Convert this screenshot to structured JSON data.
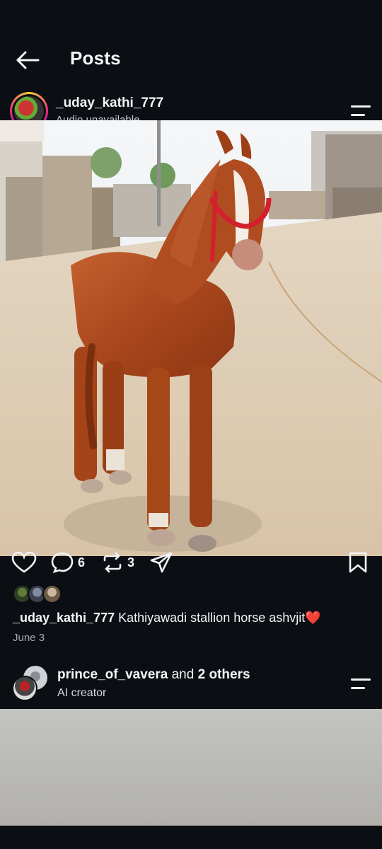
{
  "header": {
    "title": "Posts"
  },
  "post": {
    "username": "_uday_kathi_777",
    "audio_label": "Audio unavailable",
    "counts": {
      "comments": "6",
      "reposts": "3"
    },
    "caption": {
      "username": "_uday_kathi_777",
      "text": "Kathiyawadi stallion horse  ashvjit",
      "emoji": "❤️"
    },
    "date": "June 3"
  },
  "next_post": {
    "username": "prince_of_vavera",
    "and_text": "and",
    "others": "2 others",
    "subtitle": "AI creator"
  },
  "colors": {
    "background": "#0b0f14",
    "text": "#f2f4f6",
    "heart": "#e0262d"
  },
  "icons": [
    "back-arrow-icon",
    "hamburger-menu-icon",
    "heart-icon",
    "comment-icon",
    "repost-icon",
    "share-icon",
    "bookmark-icon"
  ]
}
